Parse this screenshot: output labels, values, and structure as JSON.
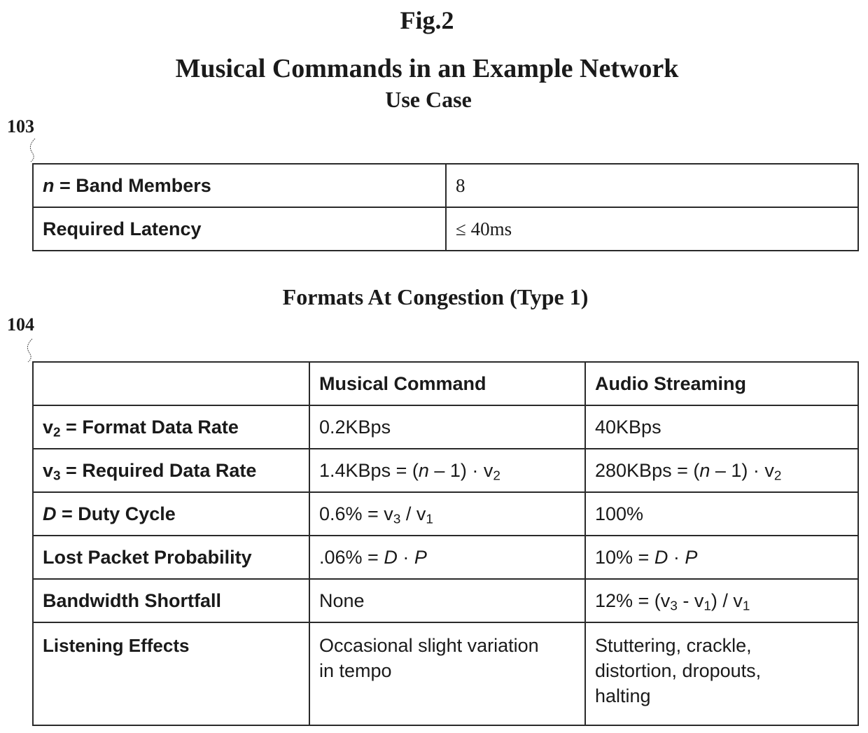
{
  "figure": {
    "label": "Fig.2",
    "title": "Musical Commands in an Example Network",
    "subtitle": "Use Case"
  },
  "use_case_table": {
    "ref_number": "103",
    "rows": [
      {
        "label_var": "n",
        "label_rest": " = Band Members",
        "value": "8"
      },
      {
        "label_var": "",
        "label_rest": "Required Latency",
        "value": "≤ 40ms"
      }
    ]
  },
  "formats_table": {
    "title": "Formats At Congestion (Type 1)",
    "ref_number": "104",
    "headers": [
      "",
      "Musical Command",
      "Audio Streaming"
    ],
    "rows": [
      {
        "label_prefix": "v",
        "label_sub": "2",
        "label_rest": " = Format Data Rate",
        "musical_command": {
          "a": "0.2KBps"
        },
        "audio_streaming": {
          "a": "40KBps"
        }
      },
      {
        "label_prefix": "v",
        "label_sub": "3",
        "label_rest": " = Required Data Rate",
        "musical_command": {
          "a": "1.4KBps = (",
          "n": "n",
          "b": " – 1) · v",
          "sub": "2"
        },
        "audio_streaming": {
          "a": "280KBps = (",
          "n": "n",
          "b": " – 1) · v",
          "sub": "2"
        }
      },
      {
        "label_var": "D",
        "label_rest": " = Duty Cycle",
        "musical_command": {
          "a": "0.6% = v",
          "sub1": "3",
          "b": " / v",
          "sub2": "1"
        },
        "audio_streaming": {
          "a": "100%"
        }
      },
      {
        "label_rest": "Lost Packet Probability",
        "musical_command": {
          "a": ".06% = ",
          "d": "D",
          "b": " · ",
          "p": "P"
        },
        "audio_streaming": {
          "a": "10% = ",
          "d": "D",
          "b": " · ",
          "p": "P"
        }
      },
      {
        "label_rest": "Bandwidth Shortfall",
        "musical_command": {
          "a": "None"
        },
        "audio_streaming": {
          "a": "12% = (v",
          "sub1": "3",
          "b": " - v",
          "sub2": "1",
          "c": ") / v",
          "sub3": "1"
        }
      },
      {
        "label_rest": "Listening Effects",
        "musical_command": {
          "line1": "Occasional slight variation",
          "line2": "in tempo"
        },
        "audio_streaming": {
          "line1": "Stuttering, crackle,",
          "line2": "distortion, dropouts,",
          "line3": "halting"
        }
      }
    ]
  }
}
